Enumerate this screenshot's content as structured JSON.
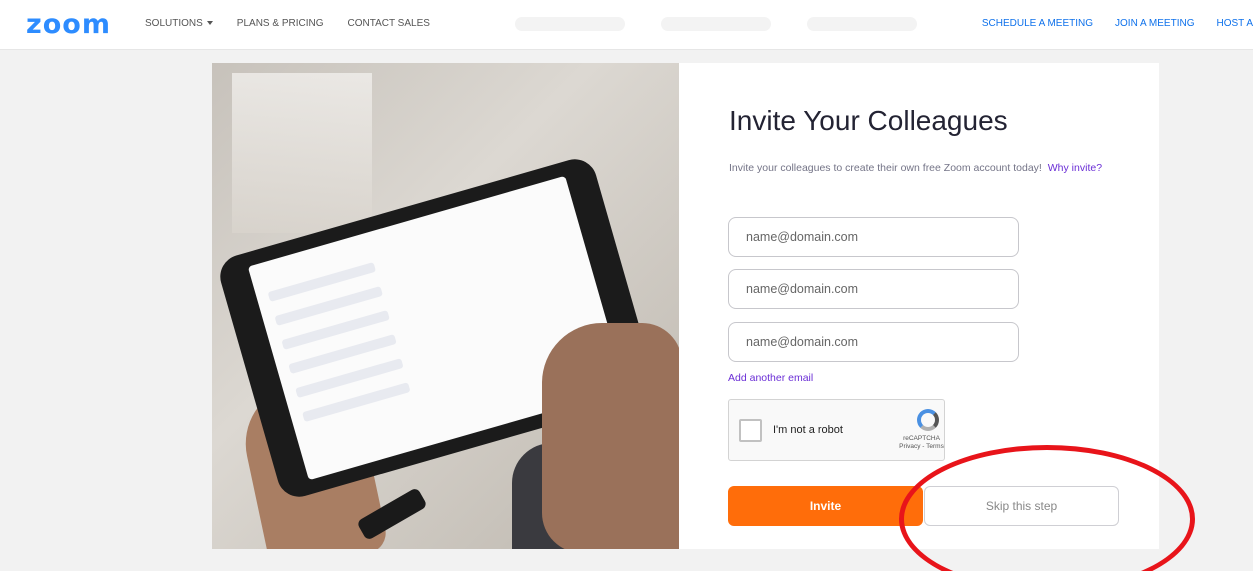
{
  "nav": {
    "logo": "zoom",
    "solutions": "SOLUTIONS",
    "plans": "PLANS & PRICING",
    "contact": "CONTACT SALES",
    "schedule": "SCHEDULE A MEETING",
    "join": "JOIN A MEETING",
    "host": "HOST A"
  },
  "invite": {
    "title": "Invite Your Colleagues",
    "subtitle": "Invite your colleagues to create their own free Zoom account today!",
    "why": "Why invite?",
    "email_placeholder": "name@domain.com",
    "add_email": "Add another email",
    "recaptcha_label": "I'm not a robot",
    "recaptcha_brand": "reCAPTCHA",
    "recaptcha_links": "Privacy - Terms",
    "invite_button": "Invite",
    "skip_button": "Skip this step"
  },
  "colors": {
    "brand": "#2D8CFF",
    "invite_button": "#ff6d0a",
    "link": "#6b2fd6",
    "annotation": "#e8141a"
  }
}
